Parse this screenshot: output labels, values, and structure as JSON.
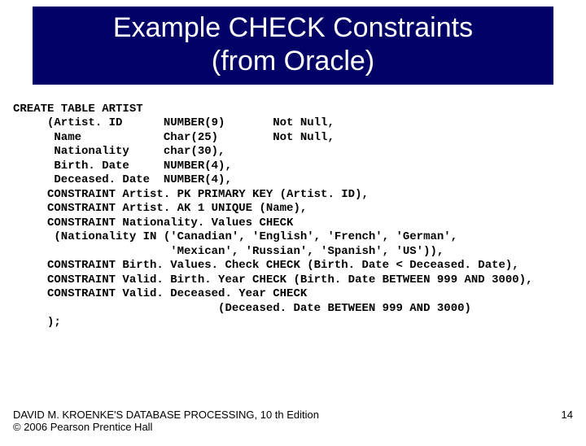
{
  "title_line1": "Example CHECK Constraints",
  "title_line2": "(from Oracle)",
  "code": "CREATE TABLE ARTIST\n     (Artist. ID      NUMBER(9)       Not Null,\n      Name            Char(25)        Not Null,\n      Nationality     char(30),\n      Birth. Date     NUMBER(4),\n      Deceased. Date  NUMBER(4),\n     CONSTRAINT Artist. PK PRIMARY KEY (Artist. ID),\n     CONSTRAINT Artist. AK 1 UNIQUE (Name),\n     CONSTRAINT Nationality. Values CHECK\n      (Nationality IN ('Canadian', 'English', 'French', 'German',\n                       'Mexican', 'Russian', 'Spanish', 'US')),\n     CONSTRAINT Birth. Values. Check CHECK (Birth. Date < Deceased. Date),\n     CONSTRAINT Valid. Birth. Year CHECK (Birth. Date BETWEEN 999 AND 3000),\n     CONSTRAINT Valid. Deceased. Year CHECK\n                              (Deceased. Date BETWEEN 999 AND 3000)\n     );",
  "footer": {
    "line1": "DAVID M. KROENKE'S DATABASE PROCESSING, 10 th Edition",
    "line2": "© 2006 Pearson Prentice Hall",
    "page": "14"
  }
}
